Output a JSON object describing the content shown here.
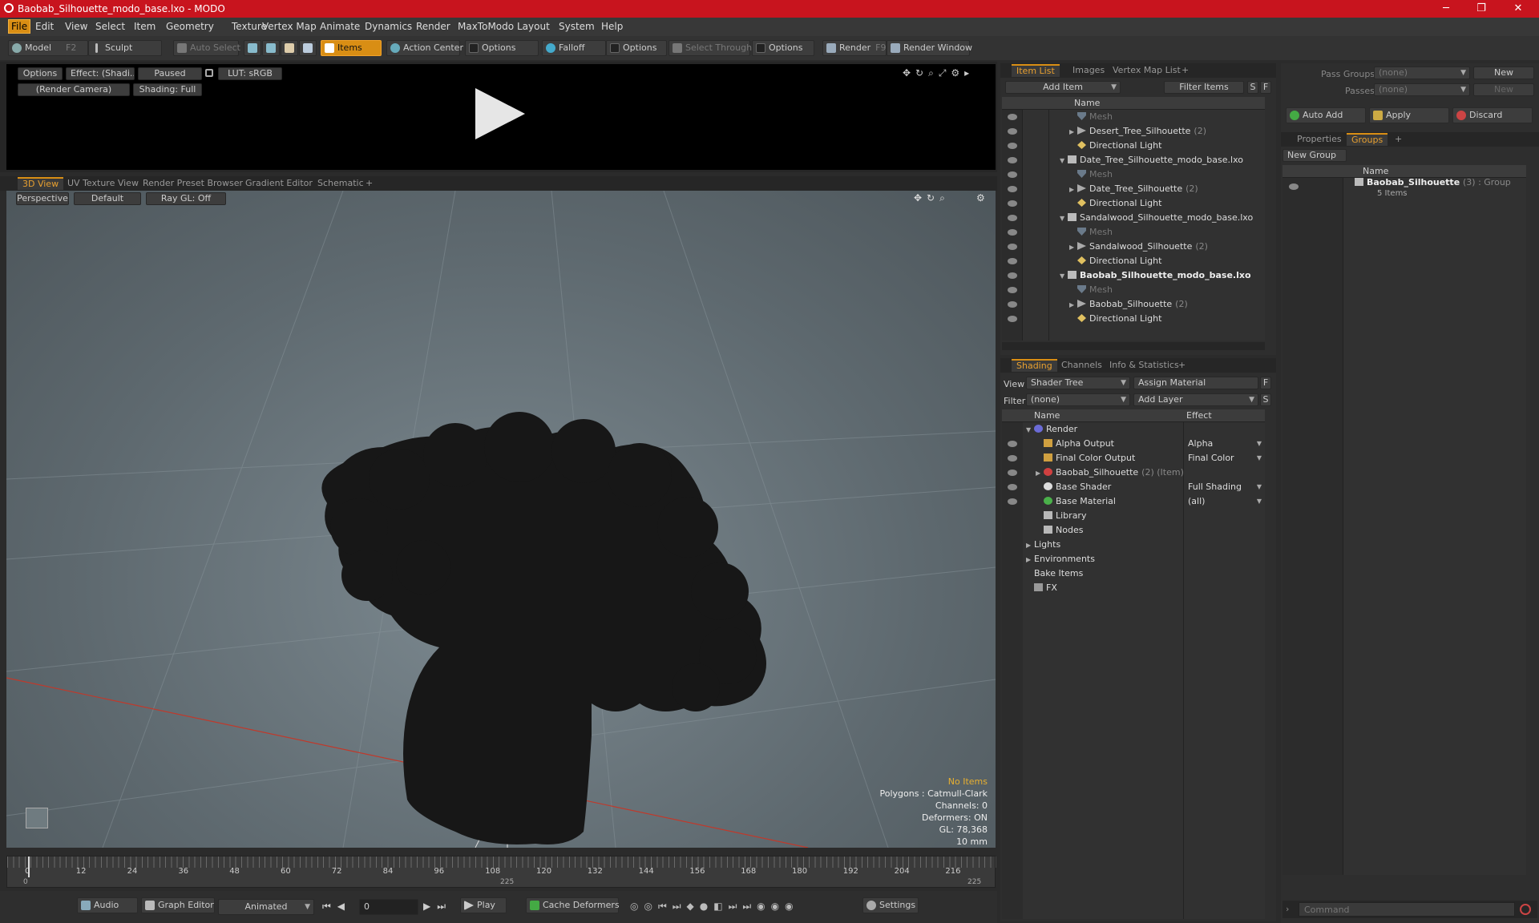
{
  "window": {
    "title": "Baobab_Silhouette_modo_base.lxo - MODO",
    "min": "─",
    "max": "❐",
    "close": "✕"
  },
  "menu": [
    "File",
    "Edit",
    "View",
    "Select",
    "Item",
    "Geometry",
    "Texture",
    "Vertex Map",
    "Animate",
    "Dynamics",
    "Render",
    "MaxToModo",
    "Layout",
    "System",
    "Help"
  ],
  "toolbar": {
    "model": "Model",
    "model_key": "F2",
    "sculpt": "Sculpt",
    "auto_select": "Auto Select",
    "items": "Items",
    "action_center": "Action Center",
    "options1": "Options",
    "falloff": "Falloff",
    "options2": "Options",
    "select_through": "Select Through",
    "options3": "Options",
    "render": "Render",
    "render_key": "F9",
    "render_window": "Render Window"
  },
  "preview": {
    "options": "Options",
    "effect": "Effect: (Shadi...",
    "paused": "Paused",
    "lut": "LUT: sRGB",
    "camera": "(Render Camera)",
    "shading": "Shading: Full"
  },
  "viewport_tabs": [
    "3D View",
    "UV Texture View",
    "Render Preset Browser",
    "Gradient Editor",
    "Schematic",
    "+"
  ],
  "viewport": {
    "perspective": "Perspective",
    "default": "Default",
    "raygl": "Ray GL: Off"
  },
  "stats": {
    "no_items": "No Items",
    "polygons": "Polygons : Catmull-Clark",
    "channels": "Channels: 0",
    "deformers": "Deformers: ON",
    "gl": "GL: 78,368",
    "scale": "10 mm"
  },
  "timeline": {
    "ticks": [
      "0",
      "12",
      "24",
      "36",
      "48",
      "60",
      "72",
      "84",
      "96",
      "108",
      "120",
      "132",
      "144",
      "156",
      "168",
      "180",
      "192",
      "204",
      "216"
    ],
    "start": "0",
    "mid": "225",
    "end": "225"
  },
  "transport": {
    "audio": "Audio",
    "graph_editor": "Graph Editor",
    "animated": "Animated",
    "frame": "0",
    "play": "Play",
    "cache_deformers": "Cache Deformers",
    "settings": "Settings"
  },
  "item_list": {
    "tabs": [
      "Item List",
      "Images",
      "Vertex Map List",
      "+"
    ],
    "add_item": "Add Item",
    "filter_items": "Filter Items",
    "s": "S",
    "f": "F",
    "col_name": "Name",
    "rows": [
      {
        "indent": 2,
        "icon": "mesh",
        "label": "Mesh",
        "count": "",
        "style": "dim",
        "tri": ""
      },
      {
        "indent": 2,
        "icon": "loc",
        "label": "Desert_Tree_Silhouette",
        "count": "(2)",
        "style": "",
        "tri": "▶"
      },
      {
        "indent": 2,
        "icon": "light",
        "label": "Directional Light",
        "count": "",
        "style": "",
        "tri": ""
      },
      {
        "indent": 1,
        "icon": "scene",
        "label": "Date_Tree_Silhouette_modo_base.lxo",
        "count": "",
        "style": "",
        "tri": "▼"
      },
      {
        "indent": 2,
        "icon": "mesh",
        "label": "Mesh",
        "count": "",
        "style": "dim",
        "tri": ""
      },
      {
        "indent": 2,
        "icon": "loc",
        "label": "Date_Tree_Silhouette",
        "count": "(2)",
        "style": "",
        "tri": "▶"
      },
      {
        "indent": 2,
        "icon": "light",
        "label": "Directional Light",
        "count": "",
        "style": "",
        "tri": ""
      },
      {
        "indent": 1,
        "icon": "scene",
        "label": "Sandalwood_Silhouette_modo_base.lxo",
        "count": "",
        "style": "",
        "tri": "▼"
      },
      {
        "indent": 2,
        "icon": "mesh",
        "label": "Mesh",
        "count": "",
        "style": "dim",
        "tri": ""
      },
      {
        "indent": 2,
        "icon": "loc",
        "label": "Sandalwood_Silhouette",
        "count": "(2)",
        "style": "",
        "tri": "▶"
      },
      {
        "indent": 2,
        "icon": "light",
        "label": "Directional Light",
        "count": "",
        "style": "",
        "tri": ""
      },
      {
        "indent": 1,
        "icon": "scene",
        "label": "Baobab_Silhouette_modo_base.lxo",
        "count": "",
        "style": "bold",
        "tri": "▼"
      },
      {
        "indent": 2,
        "icon": "mesh",
        "label": "Mesh",
        "count": "",
        "style": "dim",
        "tri": ""
      },
      {
        "indent": 2,
        "icon": "loc",
        "label": "Baobab_Silhouette",
        "count": "(2)",
        "style": "",
        "tri": "▶"
      },
      {
        "indent": 2,
        "icon": "light",
        "label": "Directional Light",
        "count": "",
        "style": "",
        "tri": ""
      }
    ]
  },
  "shading": {
    "tabs": [
      "Shading",
      "Channels",
      "Info & Statistics",
      "+"
    ],
    "view_label": "View",
    "view_value": "Shader Tree",
    "assign_material": "Assign Material",
    "filter_label": "Filter",
    "filter_value": "(none)",
    "add_layer": "Add Layer",
    "f": "F",
    "s": "S",
    "col_name": "Name",
    "col_effect": "Effect",
    "rows": [
      {
        "indent": 0,
        "icon": "render",
        "label": "Render",
        "count": "",
        "effect": "",
        "tri": "▼",
        "eye": false
      },
      {
        "indent": 1,
        "icon": "out",
        "label": "Alpha Output",
        "count": "",
        "effect": "Alpha",
        "tri": "",
        "eye": true
      },
      {
        "indent": 1,
        "icon": "out",
        "label": "Final Color Output",
        "count": "",
        "effect": "Final Color",
        "tri": "",
        "eye": true
      },
      {
        "indent": 1,
        "icon": "grp",
        "label": "Baobab_Silhouette",
        "count": "(2) (Item)",
        "effect": "",
        "tri": "▶",
        "eye": true
      },
      {
        "indent": 1,
        "icon": "shd",
        "label": "Base Shader",
        "count": "",
        "effect": "Full Shading",
        "tri": "",
        "eye": true
      },
      {
        "indent": 1,
        "icon": "mat",
        "label": "Base Material",
        "count": "",
        "effect": "(all)",
        "tri": "",
        "eye": true
      },
      {
        "indent": 1,
        "icon": "fld",
        "label": "Library",
        "count": "",
        "effect": "",
        "tri": "",
        "eye": false
      },
      {
        "indent": 1,
        "icon": "fld",
        "label": "Nodes",
        "count": "",
        "effect": "",
        "tri": "",
        "eye": false
      },
      {
        "indent": 0,
        "icon": "",
        "label": "Lights",
        "count": "",
        "effect": "",
        "tri": "▶",
        "eye": false
      },
      {
        "indent": 0,
        "icon": "",
        "label": "Environments",
        "count": "",
        "effect": "",
        "tri": "▶",
        "eye": false
      },
      {
        "indent": 0,
        "icon": "",
        "label": "Bake Items",
        "count": "",
        "effect": "",
        "tri": "",
        "eye": false
      },
      {
        "indent": 0,
        "icon": "fx",
        "label": "FX",
        "count": "",
        "effect": "",
        "tri": "",
        "eye": false
      }
    ]
  },
  "groups_panel": {
    "pass_groups": "Pass Groups",
    "passes": "Passes",
    "none": "(none)",
    "new": "New",
    "auto_add": "Auto Add",
    "apply": "Apply",
    "discard": "Discard",
    "tabs": [
      "Properties",
      "Groups",
      "+"
    ],
    "new_group": "New Group",
    "col_name": "Name",
    "group_name": "Baobab_Silhouette",
    "group_count": "(3) : Group",
    "group_items": "5 Items"
  },
  "command": {
    "placeholder": "Command"
  }
}
